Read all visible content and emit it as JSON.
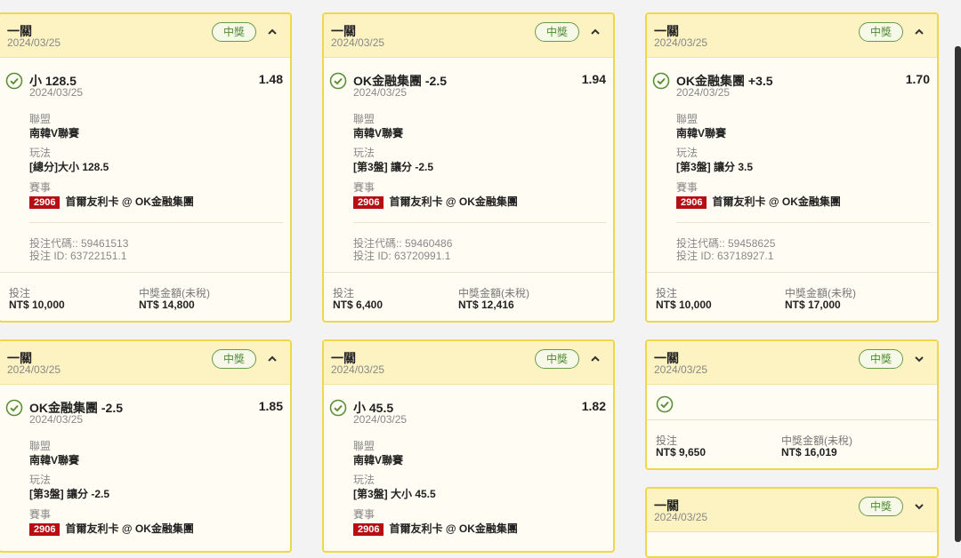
{
  "labels": {
    "won": "中獎",
    "league": "聯盟",
    "play": "玩法",
    "event": "賽事",
    "bet": "投注",
    "payout": "中獎金額(未稅)"
  },
  "cards": [
    {
      "type": "一關",
      "date": "2024/03/25",
      "sel": "小 128.5",
      "odds": "1.48",
      "sdate": "2024/03/25",
      "league": "南韓V聯賽",
      "play": "[總分]大小 128.5",
      "code": "2906",
      "event": "首爾友利卡 @ OK金融集團",
      "ticket": "投注代碼:: 59461513",
      "bid": "投注 ID: 63722151.1",
      "stake": "NT$ 10,000",
      "win": "NT$ 14,800"
    },
    {
      "type": "一關",
      "date": "2024/03/25",
      "sel": "OK金融集團 -2.5",
      "odds": "1.94",
      "sdate": "2024/03/25",
      "league": "南韓V聯賽",
      "play": "[第3盤] 讓分 -2.5",
      "code": "2906",
      "event": "首爾友利卡 @ OK金融集團",
      "ticket": "投注代碼:: 59460486",
      "bid": "投注 ID: 63720991.1",
      "stake": "NT$ 6,400",
      "win": "NT$ 12,416"
    },
    {
      "type": "一關",
      "date": "2024/03/25",
      "sel": "OK金融集團 +3.5",
      "odds": "1.70",
      "sdate": "2024/03/25",
      "league": "南韓V聯賽",
      "play": "[第3盤] 讓分 3.5",
      "code": "2906",
      "event": "首爾友利卡 @ OK金融集團",
      "ticket": "投注代碼:: 59458625",
      "bid": "投注 ID: 63718927.1",
      "stake": "NT$ 10,000",
      "win": "NT$ 17,000"
    },
    {
      "type": "一關",
      "date": "2024/03/25",
      "sel": "OK金融集團 -2.5",
      "odds": "1.85",
      "sdate": "2024/03/25",
      "league": "南韓V聯賽",
      "play": "[第3盤] 讓分 -2.5",
      "code": "2906",
      "event": "首爾友利卡 @ OK金融集團"
    },
    {
      "type": "一關",
      "date": "2024/03/25",
      "sel": "小 45.5",
      "odds": "1.82",
      "sdate": "2024/03/25",
      "league": "南韓V聯賽",
      "play": "[第3盤] 大小 45.5",
      "code": "2906",
      "event": "首爾友利卡 @ OK金融集團"
    },
    {
      "type": "一關",
      "date": "2024/03/25",
      "stake": "NT$ 9,650",
      "win": "NT$ 16,019"
    },
    {
      "type": "一關",
      "date": "2024/03/25"
    }
  ]
}
